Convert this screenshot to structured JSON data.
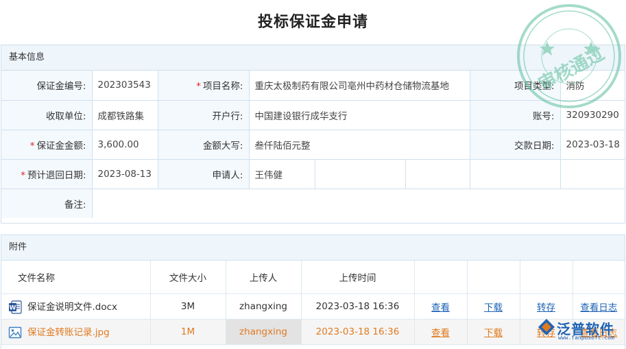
{
  "page": {
    "title": "投标保证金申请"
  },
  "basic": {
    "section_title": "基本信息",
    "deposit_no_label": "保证金编号:",
    "deposit_no": "202303543",
    "project_name_label": "项目名称:",
    "project_name": "重庆太极制药有限公司亳州中药材仓储物流基地",
    "project_type_label": "项目类型:",
    "project_type": "消防",
    "payee_label": "收取单位:",
    "payee": "成都铁路集",
    "bank_label": "开户行:",
    "bank": "中国建设银行成华支行",
    "account_label": "账号:",
    "account": "320930290",
    "amount_label": "保证金金额:",
    "amount": "3,600.00",
    "amount_cn_label": "金额大写:",
    "amount_cn": "叁仟陆佰元整",
    "pay_date_label": "交款日期:",
    "pay_date": "2023-03-18",
    "return_date_label": "预计退回日期:",
    "return_date": "2023-08-13",
    "applicant_label": "申请人:",
    "applicant": "王伟健",
    "remark_label": "备注:",
    "remark": ""
  },
  "attachments": {
    "section_title": "附件",
    "headers": {
      "name": "文件名称",
      "size": "文件大小",
      "uploader": "上传人",
      "time": "上传时间"
    },
    "files": [
      {
        "name": "保证金说明文件.docx",
        "size": "3M",
        "uploader": "zhangxing",
        "time": "2023-03-18 16:36",
        "icon": "word-doc-icon"
      },
      {
        "name": "保证金转账记录.jpg",
        "size": "1M",
        "uploader": "zhangxing",
        "time": "2023-03-18 16:36",
        "icon": "image-file-icon"
      }
    ],
    "actions": {
      "view": "查看",
      "download": "下载",
      "transfer": "转存",
      "log": "查看日志"
    }
  },
  "stamp": {
    "text": "审核通过",
    "color": "#5bbf9a"
  },
  "logo": {
    "text": "泛普软件",
    "url": "www.fanpusoft.com",
    "color": "#1f63b4"
  },
  "colors": {
    "accent": "#1f63b4",
    "required": "#e02020",
    "highlight_row": "#e07a1f"
  }
}
